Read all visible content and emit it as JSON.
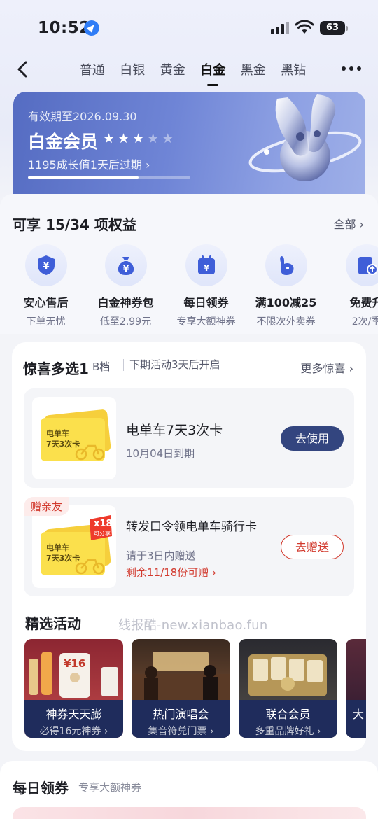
{
  "status_bar": {
    "time": "10:52",
    "battery": "63"
  },
  "nav": {
    "tabs": [
      "普通",
      "白银",
      "黄金",
      "白金",
      "黑金",
      "黑钻"
    ],
    "active_tab": "白金"
  },
  "member_card": {
    "valid_until": "有效期至2026.09.30",
    "level": "白金会员",
    "stars_filled": 3,
    "stars_total": 5,
    "growth_note": "1195成长值1天后过期 ›",
    "progress": 0.68,
    "colors": {
      "start": "#556cc2",
      "end": "#9eafe8"
    }
  },
  "benefits": {
    "title": "可享 15/34 项权益",
    "more": "全部 ›",
    "items": [
      {
        "name": "安心售后",
        "desc": "下单无忧",
        "icon": "shield-yen-icon"
      },
      {
        "name": "白金神券包",
        "desc": "低至2.99元",
        "icon": "money-bag-icon"
      },
      {
        "name": "每日领券",
        "desc": "专享大额神券",
        "icon": "calendar-yen-icon"
      },
      {
        "name": "满100减25",
        "desc": "不限次外卖券",
        "icon": "kangaroo-icon"
      },
      {
        "name": "免费升",
        "desc": "2次/季",
        "icon": "upgrade-card-icon"
      }
    ]
  },
  "surprise": {
    "title": "惊喜多选1",
    "tier": "B档",
    "next": "下期活动3天后开启",
    "more": "更多惊喜 ›",
    "coupon1": {
      "card_text_1": "电单车",
      "card_text_2": "7天3次卡",
      "title": "电单车7天3次卡",
      "expiry": "10月04日到期",
      "button": "去使用"
    },
    "coupon2": {
      "flag": "赠亲友",
      "card_text_1": "电单车",
      "card_text_2": "7天3次卡",
      "badge": "x18",
      "badge_sub": "可分享",
      "title": "转发口令领电单车骑行卡",
      "note": "请于3日内赠送",
      "remain": "剩余11/18份可赠 ›",
      "button": "去赠送"
    }
  },
  "activities": {
    "title": "精选活动",
    "watermark": "线报酷-new.xianbao.fun",
    "items": [
      {
        "name": "神券天天膨",
        "sub": "必得16元神券 ›",
        "tag": "¥16"
      },
      {
        "name": "热门演唱会",
        "sub": "集音符兑门票 ›"
      },
      {
        "name": "联合会员",
        "sub": "多重品牌好礼 ›"
      },
      {
        "name": "大",
        "sub": ""
      }
    ]
  },
  "daily": {
    "title": "每日领券",
    "sub": "专享大额神券"
  }
}
